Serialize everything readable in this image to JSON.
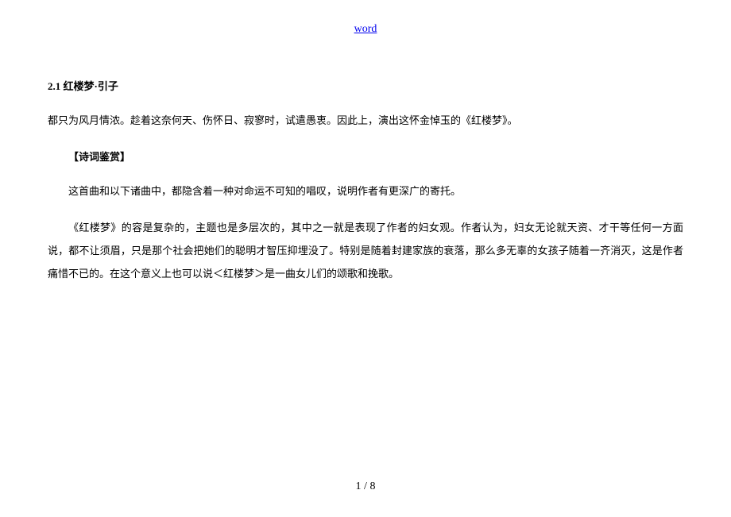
{
  "header": {
    "link_text": "word"
  },
  "document": {
    "section_title": "2.1 红楼梦·引子",
    "para1": "都只为风月情浓。趁着这奈何天、伤怀日、寂寥时，试遣愚衷。因此上，演出这怀金悼玉的《红楼梦》。",
    "subheading": "【诗词鉴赏】",
    "para2": "这首曲和以下诸曲中，都隐含着一种对命运不可知的唱叹，说明作者有更深广的寄托。",
    "para3": "《红楼梦》的容是复杂的，主题也是多层次的，其中之一就是表现了作者的妇女观。作者认为，妇女无论就天资、才干等任何一方面说，都不让须眉，只是那个社会把她们的聪明才智压抑埋没了。特别是随着封建家族的衰落，那么多无辜的女孩子随着一齐消灭，这是作者痛惜不已的。在这个意义上也可以说＜红楼梦＞是一曲女儿们的颂歌和挽歌。"
  },
  "pagination": {
    "current": "1",
    "separator": " / ",
    "total": "8"
  }
}
